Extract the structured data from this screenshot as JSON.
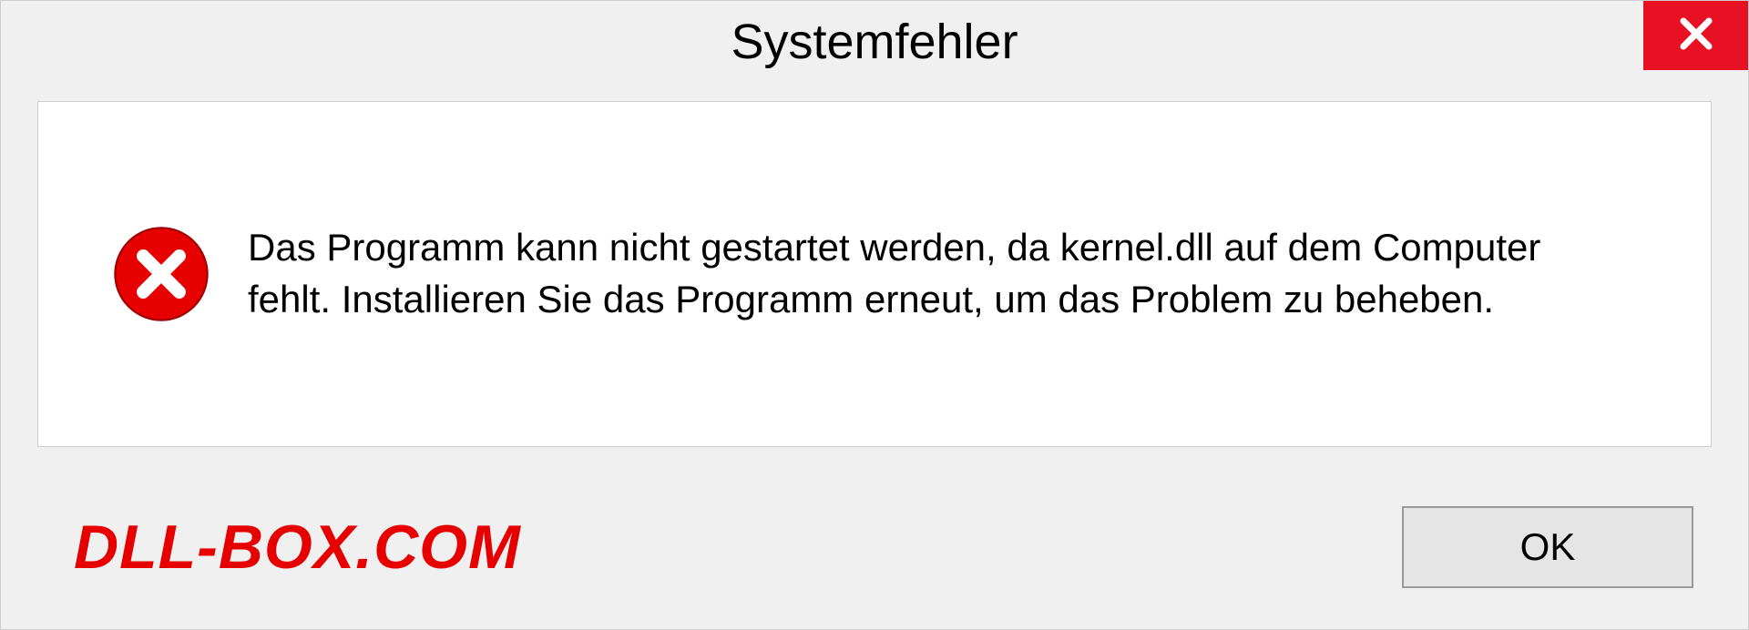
{
  "dialog": {
    "title": "Systemfehler",
    "message": "Das Programm kann nicht gestartet werden, da kernel.dll auf dem Computer fehlt. Installieren Sie das Programm erneut, um das Problem zu beheben.",
    "ok_label": "OK"
  },
  "watermark": "DLL-BOX.COM",
  "colors": {
    "close_button_bg": "#e81123",
    "error_icon_fill": "#e60000",
    "watermark_color": "#e60000"
  }
}
